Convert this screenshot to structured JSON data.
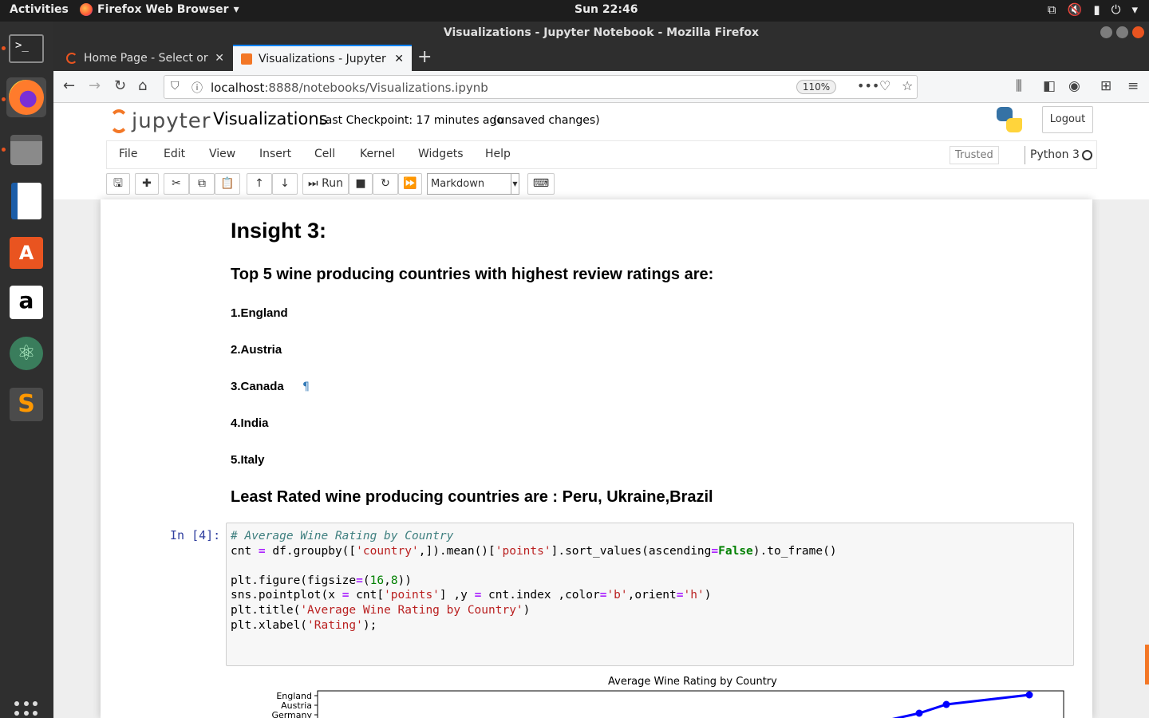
{
  "topbar": {
    "activities": "Activities",
    "app": "Firefox Web Browser",
    "clock": "Sun 22:46"
  },
  "window": {
    "title": "Visualizations - Jupyter Notebook - Mozilla Firefox"
  },
  "tabs": [
    {
      "label": "Home Page - Select or cre",
      "active": false
    },
    {
      "label": "Visualizations - Jupyter N",
      "active": true
    }
  ],
  "navbar": {
    "url_host": "localhost",
    "url_rest": ":8888/notebooks/Visualizations.ipynb",
    "zoom": "110%"
  },
  "jupyter": {
    "logo_text": "jupyter",
    "notebook_title": "Visualizations",
    "checkpoint": "Last Checkpoint: 17 minutes ago",
    "unsaved": "(unsaved changes)",
    "logout": "Logout",
    "menu": [
      "File",
      "Edit",
      "View",
      "Insert",
      "Cell",
      "Kernel",
      "Widgets",
      "Help"
    ],
    "trusted": "Trusted",
    "kernel": "Python 3",
    "run_label": "Run",
    "cell_type": "Markdown"
  },
  "notebook": {
    "insight_heading": "Insight 3:",
    "top5_heading": "Top 5 wine producing countries with highest review ratings are:",
    "countries": [
      "1.England",
      "2.Austria",
      "3.Canada",
      "4.India",
      "5.Italy"
    ],
    "least_rated": "Least Rated wine producing countries are : Peru, Ukraine,Brazil",
    "pilcrow": "¶",
    "prompt": "In [4]:",
    "plot_title": "Average Wine Rating by Country",
    "plot_ylabels": [
      "England",
      "Austria",
      "Germany"
    ]
  }
}
